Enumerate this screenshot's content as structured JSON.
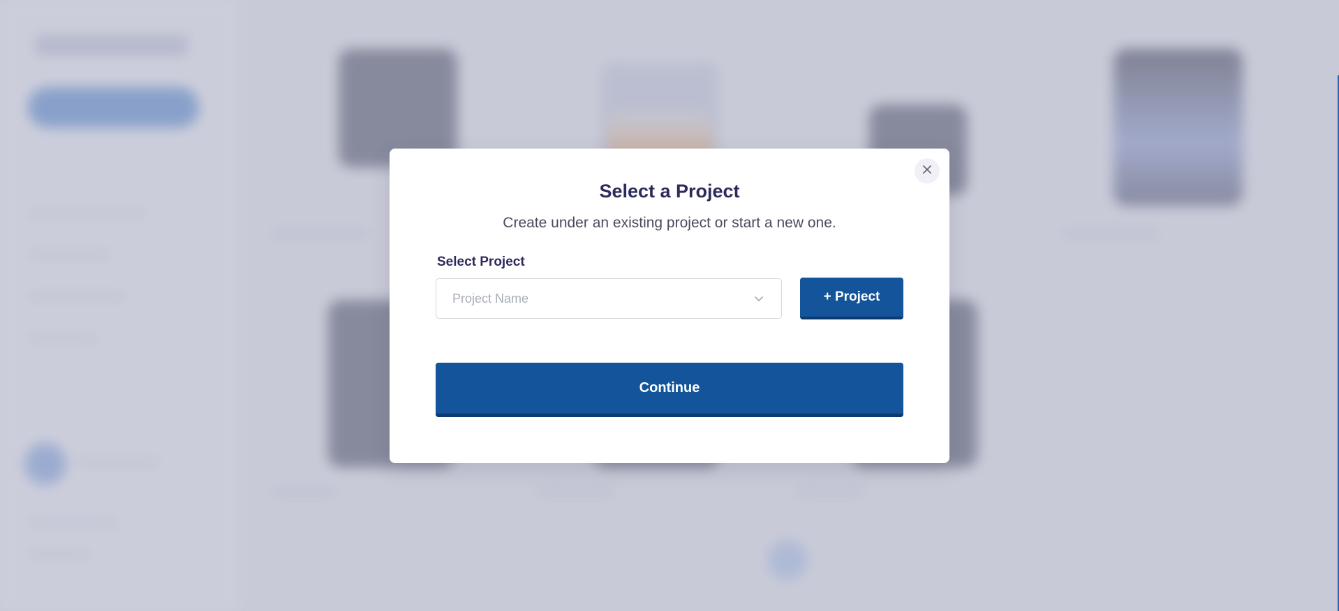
{
  "modal": {
    "title": "Select a Project",
    "subtitle": "Create under an existing project or start a new one.",
    "field_label": "Select Project",
    "select_placeholder": "Project Name",
    "add_project_label": "+ Project",
    "continue_label": "Continue",
    "close_icon": "close-icon",
    "chevron_icon": "chevron-down-icon"
  },
  "colors": {
    "primary": "#13549a",
    "title": "#2d2a5c",
    "overlay": "#cfd0dc"
  }
}
